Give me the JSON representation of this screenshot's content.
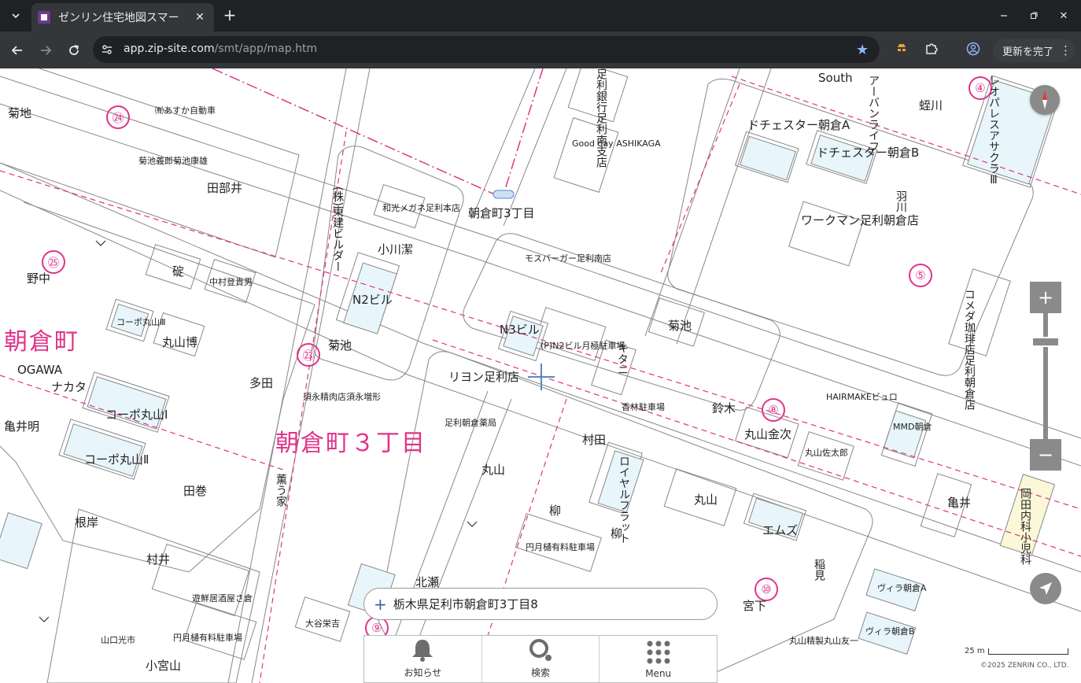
{
  "browser": {
    "tab_title": "ゼンリン住宅地図スマー",
    "url_host": "app.zip-site.com",
    "url_path": "/smt/app/map.htm",
    "update_label": "更新を完了",
    "update_menu_icon": "⋮"
  },
  "map": {
    "district_labels": {
      "main_district": "朝倉町３丁目",
      "left_district": "朝倉町",
      "intersection": "朝倉町3丁目"
    },
    "block_numbers": {
      "b24": "㉔",
      "b25": "㉕",
      "b23": "㉓",
      "b4": "④",
      "b5": "⑤",
      "b8": "⑧",
      "b10": "⑩",
      "b9": "⑨"
    },
    "buildings": {
      "kikuchi_top": "菊地",
      "asuka": "㈲あすか自動車",
      "denma": "田部井",
      "kikuchi_kenso": "菊池義郎菊池康雄",
      "nonaka": "野中",
      "ikari": "碇",
      "nakamura": "中村登貴男",
      "maruyama_kaoru": "丸山博",
      "coop3": "コーポ丸山Ⅲ",
      "ogawa": "OGAWA",
      "nakata": "ナカタ",
      "kamei_akira": "亀井明",
      "coop1": "コーポ丸山Ⅰ",
      "coop2": "コーポ丸山Ⅱ",
      "tamaki": "田巻",
      "negishi": "根岸",
      "murai": "村井",
      "yamaguchi": "山口光市",
      "komiya": "小宮山",
      "izakaya": "遊鮮居酒屋さ倉",
      "parking_left": "円月樋有料駐車場",
      "kawamata": "(株)東建ビルダー",
      "wako": "和光メガネ足利本店",
      "ogawa_kiyoshi": "小川潔",
      "n2": "N2ビル",
      "kikuchi_mid": "菊池",
      "tada": "多田",
      "sugamo": "須永精肉店須永増形",
      "kaoru_ie": "薫う家",
      "n3": "N3ビル",
      "parking_mid": "(P)N2ビル月極駐車場",
      "mos": "モスバーガー足利南店",
      "kitani": "キタニ",
      "kikuchi_right": "菊池",
      "kashiwabayashi": "香林駐車場",
      "lyon": "リヨン足利店",
      "ashikaga_ph": "足利朝倉薬局",
      "maruyama_center": "丸山",
      "murata": "村田",
      "royal": "ロイヤルフラット",
      "yanagi1": "柳",
      "yanagi2": "柳",
      "parking_bottom": "円月樋有料駐車場",
      "kitase": "北瀬",
      "ootani": "大谷栄吉",
      "suzuki": "鈴木",
      "maruyama_kinji": "丸山金次",
      "maruyama_sataro": "丸山佐太郎",
      "hairmake": "HAIRMAKEビュロ",
      "mmd": "MMD朝倉",
      "maruyama_right": "丸山",
      "emuzu": "エムズ",
      "inami": "稲見",
      "kamei_right": "亀井",
      "okada": "岡田内科小児科",
      "miyashita": "宮下",
      "villa_a": "ヴィラ朝倉A",
      "villa_b": "ヴィラ朝倉B",
      "seimen": "丸山精製丸山友一",
      "dochester_a": "ドチェスター朝倉A",
      "dochester_b": "ドチェスター朝倉B",
      "hanyu": "羽川",
      "workman": "ワークマン足利朝倉店",
      "komeda": "コメダ珈琲店足利朝倉店",
      "leo": "レオパレスアサクラⅢ",
      "urban": "アーバンライフ",
      "hotokawa": "蛭川",
      "gooday": "Good day ASHIKAGA",
      "ashikaga_bank": "足利銀行足利南支店",
      "south": "South"
    },
    "crosshair_icon": "crosshair-icon"
  },
  "controls": {
    "zoom_in": "+",
    "zoom_out": "−",
    "zoom_level": 0.85,
    "compass_icon": "compass-icon",
    "locate_icon": "locate-arrow-icon"
  },
  "search": {
    "address": "栃木県足利市朝倉町3丁目8"
  },
  "bottom_nav": {
    "items": [
      {
        "label": "お知らせ",
        "icon": "bell-icon"
      },
      {
        "label": "検索",
        "icon": "search-icon"
      },
      {
        "label": "Menu",
        "icon": "grid-menu-icon"
      }
    ]
  },
  "scale": {
    "label": "25 m"
  },
  "copyright": "©2025 ZENRIN CO., LTD.",
  "colors": {
    "road_pink": "#e0338a",
    "control_gray": "#8a8a8a",
    "browser_dark": "#202124"
  }
}
